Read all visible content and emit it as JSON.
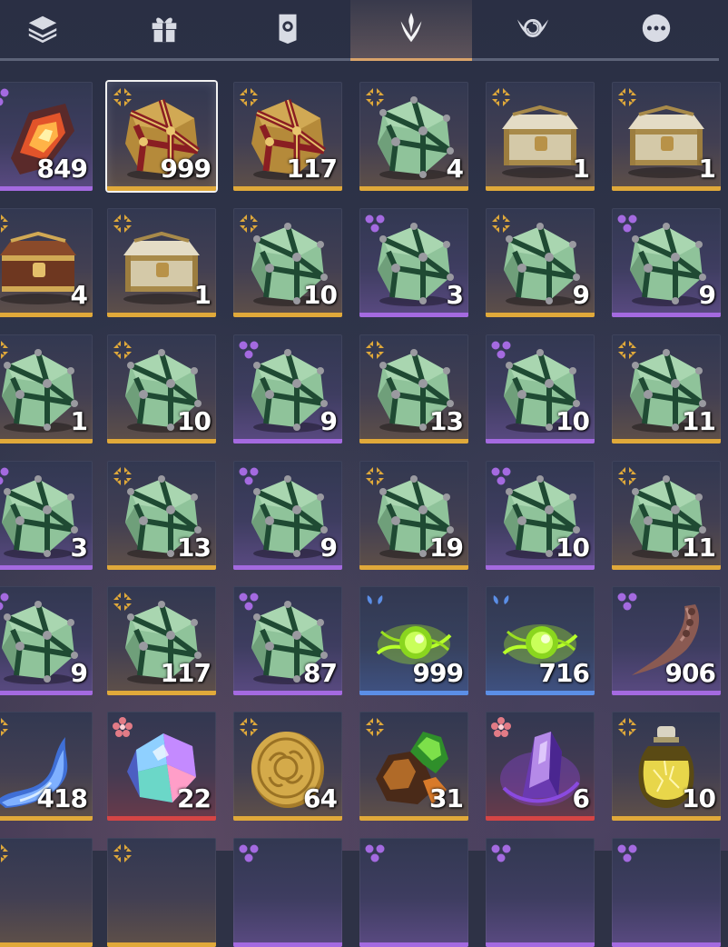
{
  "tabs": [
    {
      "id": "layers",
      "icon": "layers-icon",
      "active": false
    },
    {
      "id": "gift",
      "icon": "gift-icon",
      "active": false
    },
    {
      "id": "emblem",
      "icon": "shield-emblem-icon",
      "active": false
    },
    {
      "id": "flame",
      "icon": "flame-crest-icon",
      "active": true
    },
    {
      "id": "spiral",
      "icon": "spiral-wings-icon",
      "active": false
    },
    {
      "id": "more",
      "icon": "more-dots-icon",
      "active": false
    }
  ],
  "colors": {
    "gold": "#e0a93a",
    "purple": "#a46ae0",
    "blue": "#5b8ee6",
    "red": "#d54545",
    "active_tab": "#d9a46a"
  },
  "inventory": {
    "rows": [
      [
        {
          "item": "fire-crystal",
          "rarity": "purple",
          "qty": "849",
          "selected": false
        },
        {
          "item": "gold-crate",
          "rarity": "gold",
          "qty": "999",
          "selected": true
        },
        {
          "item": "gold-crate",
          "rarity": "gold",
          "qty": "117",
          "selected": false
        },
        {
          "item": "jade-crate",
          "rarity": "gold",
          "qty": "4",
          "selected": false
        },
        {
          "item": "silver-chest",
          "rarity": "gold",
          "qty": "1",
          "selected": false
        },
        {
          "item": "silver-chest",
          "rarity": "gold",
          "qty": "1",
          "selected": false
        }
      ],
      [
        {
          "item": "bronze-chest",
          "rarity": "gold",
          "qty": "4"
        },
        {
          "item": "silver-chest",
          "rarity": "gold",
          "qty": "1"
        },
        {
          "item": "jade-crate",
          "rarity": "gold",
          "qty": "10"
        },
        {
          "item": "jade-crate",
          "rarity": "purple",
          "qty": "3"
        },
        {
          "item": "jade-crate",
          "rarity": "gold",
          "qty": "9"
        },
        {
          "item": "jade-crate",
          "rarity": "purple",
          "qty": "9"
        }
      ],
      [
        {
          "item": "jade-crate",
          "rarity": "gold",
          "qty": "1"
        },
        {
          "item": "jade-crate",
          "rarity": "gold",
          "qty": "10"
        },
        {
          "item": "jade-crate",
          "rarity": "purple",
          "qty": "9"
        },
        {
          "item": "jade-crate",
          "rarity": "gold",
          "qty": "13"
        },
        {
          "item": "jade-crate",
          "rarity": "purple",
          "qty": "10"
        },
        {
          "item": "jade-crate",
          "rarity": "gold",
          "qty": "11"
        }
      ],
      [
        {
          "item": "jade-crate",
          "rarity": "purple",
          "qty": "3"
        },
        {
          "item": "jade-crate",
          "rarity": "gold",
          "qty": "13"
        },
        {
          "item": "jade-crate",
          "rarity": "purple",
          "qty": "9"
        },
        {
          "item": "jade-crate",
          "rarity": "gold",
          "qty": "19"
        },
        {
          "item": "jade-crate",
          "rarity": "purple",
          "qty": "10"
        },
        {
          "item": "jade-crate",
          "rarity": "gold",
          "qty": "11"
        }
      ],
      [
        {
          "item": "jade-crate",
          "rarity": "purple",
          "qty": "9"
        },
        {
          "item": "jade-crate",
          "rarity": "gold",
          "qty": "117"
        },
        {
          "item": "jade-crate",
          "rarity": "purple",
          "qty": "87"
        },
        {
          "item": "green-orb",
          "rarity": "blue",
          "qty": "999"
        },
        {
          "item": "green-orb",
          "rarity": "blue",
          "qty": "716"
        },
        {
          "item": "claw-fang",
          "rarity": "purple",
          "qty": "906"
        }
      ],
      [
        {
          "item": "blue-flame",
          "rarity": "gold",
          "qty": "418"
        },
        {
          "item": "prism-gem",
          "rarity": "red",
          "qty": "22"
        },
        {
          "item": "gold-coin",
          "rarity": "gold",
          "qty": "64"
        },
        {
          "item": "ore-cluster",
          "rarity": "gold",
          "qty": "31"
        },
        {
          "item": "amethyst-shard",
          "rarity": "red",
          "qty": "6"
        },
        {
          "item": "elixir-bottle",
          "rarity": "gold",
          "qty": "10"
        }
      ],
      [
        {
          "item": "partial",
          "rarity": "gold",
          "qty": ""
        },
        {
          "item": "partial",
          "rarity": "gold",
          "qty": ""
        },
        {
          "item": "partial",
          "rarity": "purple",
          "qty": ""
        },
        {
          "item": "partial",
          "rarity": "purple",
          "qty": ""
        },
        {
          "item": "partial",
          "rarity": "purple",
          "qty": ""
        },
        {
          "item": "partial",
          "rarity": "purple",
          "qty": ""
        }
      ]
    ]
  }
}
